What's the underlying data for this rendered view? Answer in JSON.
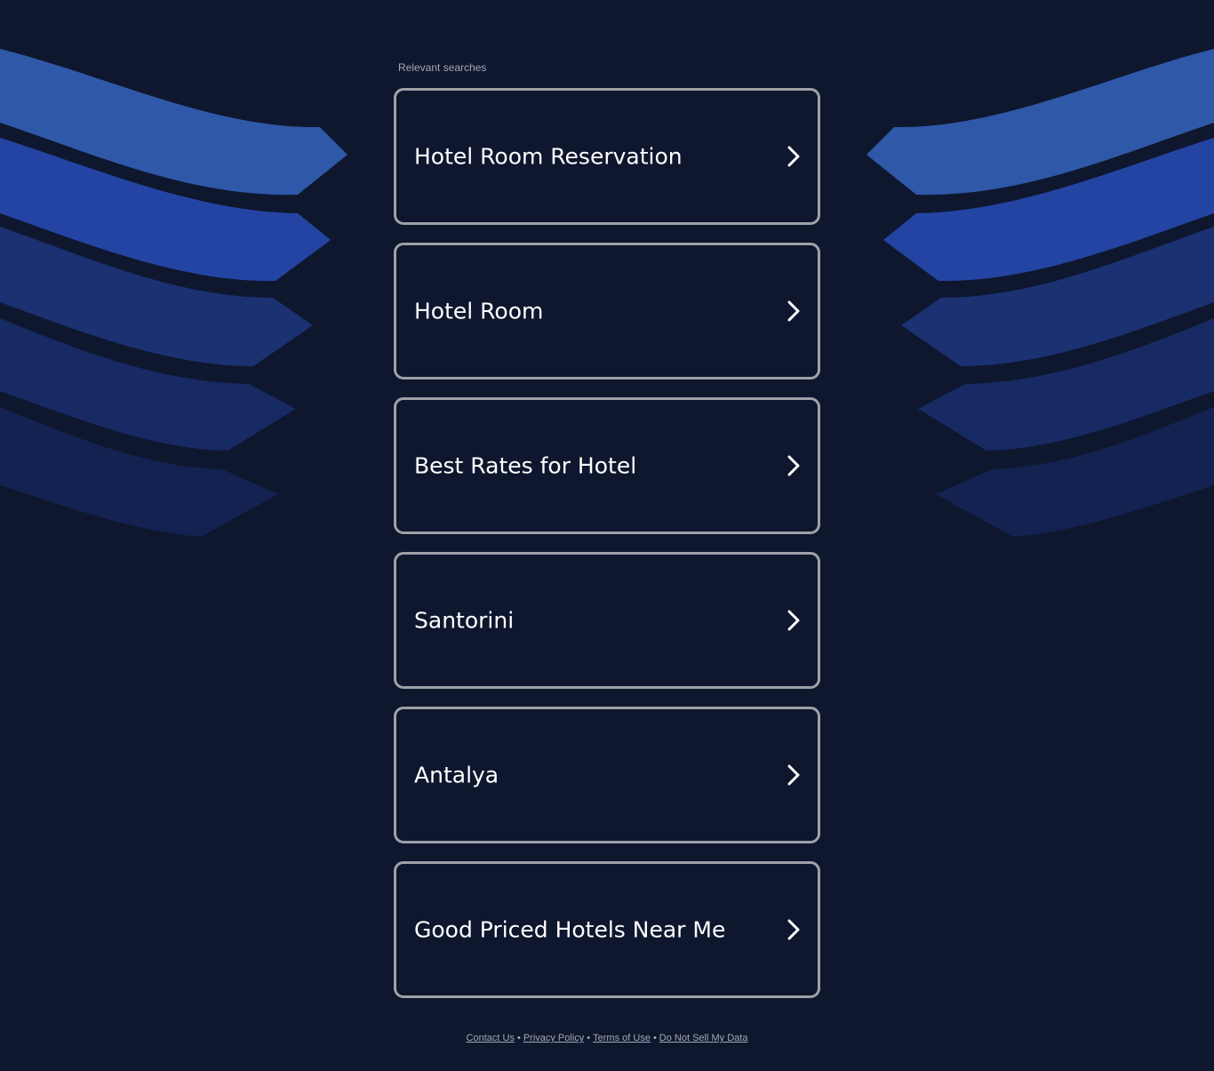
{
  "heading": "Relevant searches",
  "results": [
    {
      "label": "Hotel Room Reservation"
    },
    {
      "label": "Hotel Room"
    },
    {
      "label": "Best Rates for Hotel"
    },
    {
      "label": "Santorini"
    },
    {
      "label": "Antalya"
    },
    {
      "label": "Good Priced Hotels Near Me"
    }
  ],
  "footer": {
    "links": [
      "Contact Us",
      "Privacy Policy",
      "Terms of Use",
      "Do Not Sell My Data"
    ],
    "separator": "•"
  },
  "colors": {
    "background": "#0e172e",
    "card_border": "#9ea2a8",
    "card_text": "#ffffff",
    "muted_text": "#a4a9b4",
    "ribbon_1": "#2f58a8",
    "ribbon_2": "#2444a4",
    "ribbon_3": "#1b3172",
    "ribbon_4": "#172a64",
    "ribbon_5": "#132250"
  },
  "icons": {
    "card_action": "chevron-right-icon"
  }
}
